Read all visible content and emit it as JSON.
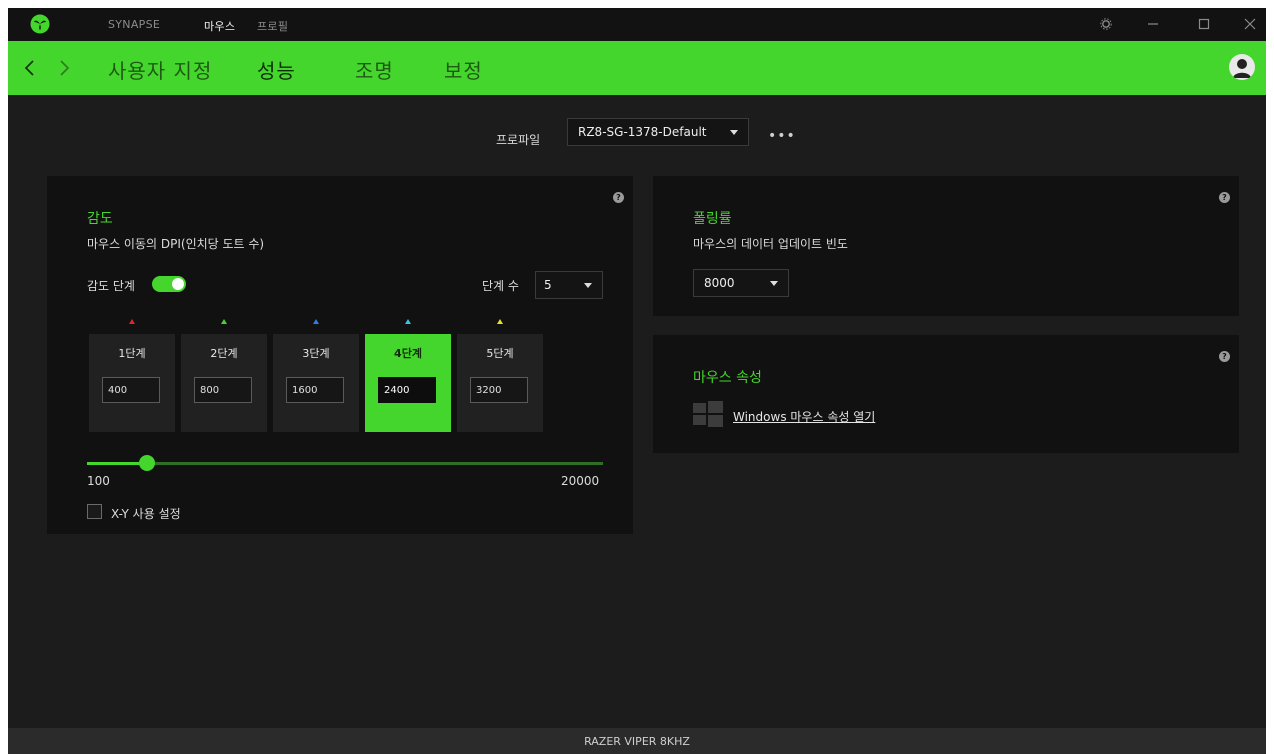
{
  "titlebar": {
    "tabs": [
      {
        "label": "SYNAPSE",
        "active": false
      },
      {
        "label": "마우스",
        "active": true
      },
      {
        "label": "프로필",
        "active": false
      }
    ]
  },
  "navbar": {
    "subtabs": [
      {
        "label": "사용자 지정",
        "active": false
      },
      {
        "label": "성능",
        "active": true
      },
      {
        "label": "조명",
        "active": false
      },
      {
        "label": "보정",
        "active": false
      }
    ]
  },
  "profile": {
    "label": "프로파일",
    "selected": "RZ8-SG-1378-Default",
    "more": "•••"
  },
  "sensitivity": {
    "title": "감도",
    "subtitle": "마우스 이동의 DPI(인치당 도트 수)",
    "stages_label": "감도 단계",
    "stages_enabled": true,
    "stage_count_label": "단계 수",
    "stage_count": "5",
    "stages": [
      {
        "label": "1단계",
        "value": "400",
        "color": "#e0262a",
        "active": false
      },
      {
        "label": "2단계",
        "value": "800",
        "color": "#44d62c",
        "active": false
      },
      {
        "label": "3단계",
        "value": "1600",
        "color": "#2f7de0",
        "active": false
      },
      {
        "label": "4단계",
        "value": "2400",
        "color": "#35c3e6",
        "active": true
      },
      {
        "label": "5단계",
        "value": "3200",
        "color": "#e5e02a",
        "active": false
      }
    ],
    "min": "100",
    "max": "20000",
    "current_dpi": 2400,
    "xy_label": "X-Y 사용 설정",
    "xy_checked": false
  },
  "polling": {
    "title": "폴링률",
    "subtitle": "마우스의 데이터 업데이트 빈도",
    "selected": "8000"
  },
  "mouse_props": {
    "title": "마우스 속성",
    "link": "Windows 마우스 속성 열기"
  },
  "footer": {
    "device": "RAZER VIPER 8KHZ"
  },
  "colors": {
    "accent": "#44d62c",
    "background": "#1c1c1c",
    "panel": "#111111"
  },
  "icons": [
    "razer-logo-icon",
    "settings-icon",
    "minimize-icon",
    "maximize-icon",
    "close-icon",
    "back-arrow-icon",
    "forward-arrow-icon",
    "avatar-icon",
    "help-icon",
    "windows-logo-icon"
  ]
}
